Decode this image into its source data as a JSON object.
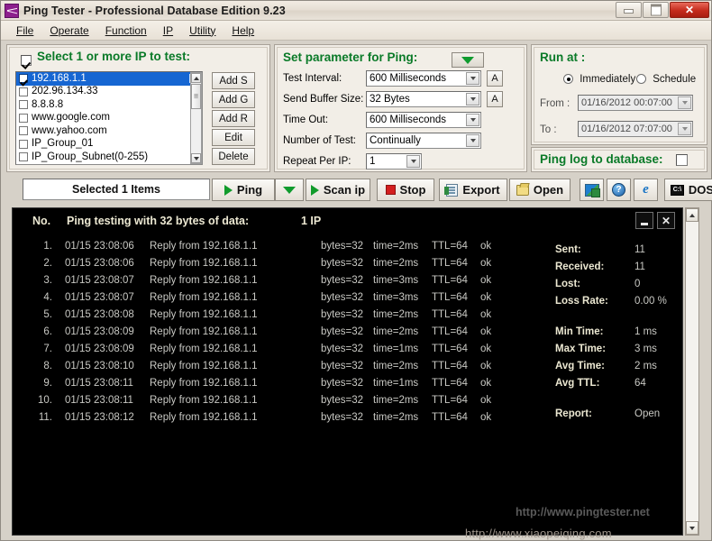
{
  "window": {
    "title": "Ping Tester - Professional Database Edition  9.23",
    "app_icon": "waveform-icon",
    "minimize": "minimize-icon",
    "maximize": "maximize-icon",
    "close": "✕"
  },
  "menu": [
    {
      "label": "File"
    },
    {
      "label": "Operate"
    },
    {
      "label": "Function"
    },
    {
      "label": "IP"
    },
    {
      "label": "Utility"
    },
    {
      "label": "Help"
    }
  ],
  "select_group": {
    "title": "Select 1 or more IP to test:",
    "checked": true,
    "items": [
      {
        "label": "192.168.1.1",
        "checked": true,
        "selected": true
      },
      {
        "label": "202.96.134.33",
        "checked": false,
        "selected": false
      },
      {
        "label": "8.8.8.8",
        "checked": false,
        "selected": false
      },
      {
        "label": "www.google.com",
        "checked": false,
        "selected": false
      },
      {
        "label": "www.yahoo.com",
        "checked": false,
        "selected": false
      },
      {
        "label": "IP_Group_01",
        "checked": false,
        "selected": false
      },
      {
        "label": "IP_Group_Subnet(0-255)",
        "checked": false,
        "selected": false
      }
    ],
    "buttons": [
      {
        "label": "Add S"
      },
      {
        "label": "Add G"
      },
      {
        "label": "Add R"
      },
      {
        "label": "Edit"
      },
      {
        "label": "Delete"
      }
    ]
  },
  "param_group": {
    "title": "Set parameter for Ping:",
    "dropdown_icon": "green-triangle-down-icon",
    "rows": [
      {
        "label": "Test Interval:",
        "value": "600  Milliseconds",
        "aux": "A"
      },
      {
        "label": "Send Buffer Size:",
        "value": "32  Bytes",
        "aux": "A"
      },
      {
        "label": "Time Out:",
        "value": "600  Milliseconds",
        "aux": ""
      },
      {
        "label": "Number of Test:",
        "value": "Continually",
        "aux": ""
      },
      {
        "label": "Repeat Per IP:",
        "value": "1",
        "aux": ""
      }
    ]
  },
  "runat_group": {
    "title": "Run at :",
    "radio_immediately": "Immediately",
    "radio_schedule": "Schedule",
    "selected_radio": "Immediately",
    "from_label": "From :",
    "from_value": "01/16/2012 00:07:00",
    "to_label": "To :",
    "to_value": "01/16/2012 07:07:00"
  },
  "pinglog_group": {
    "title": "Ping log to database:",
    "checked": false
  },
  "toolbar": {
    "selected_items": "Selected 1 Items",
    "ping_label": "Ping",
    "ping_dropdown_icon": "green-triangle-down-icon",
    "scan_label": "Scan ip",
    "stop_label": "Stop",
    "export_label": "Export",
    "open_label": "Open",
    "image_icon": "image-export-icon",
    "help_icon": "help-question-icon",
    "browser_icon": "internet-explorer-icon",
    "dos_label": "DOS",
    "dos_icon": "dos-console-icon"
  },
  "console": {
    "header_no": "No.",
    "header_title": "Ping testing with 32 bytes of data:",
    "header_ipcount": "1  IP",
    "minimize_icon": "minimize-icon",
    "close_icon": "✕",
    "rows": [
      {
        "no": "1.",
        "time": "01/15 23:08:06",
        "reply": "Reply from 192.168.1.1",
        "bytes": "bytes=32",
        "ms": "time=2ms",
        "ttl": "TTL=64",
        "status": "ok"
      },
      {
        "no": "2.",
        "time": "01/15 23:08:06",
        "reply": "Reply from 192.168.1.1",
        "bytes": "bytes=32",
        "ms": "time=2ms",
        "ttl": "TTL=64",
        "status": "ok"
      },
      {
        "no": "3.",
        "time": "01/15 23:08:07",
        "reply": "Reply from 192.168.1.1",
        "bytes": "bytes=32",
        "ms": "time=3ms",
        "ttl": "TTL=64",
        "status": "ok"
      },
      {
        "no": "4.",
        "time": "01/15 23:08:07",
        "reply": "Reply from 192.168.1.1",
        "bytes": "bytes=32",
        "ms": "time=3ms",
        "ttl": "TTL=64",
        "status": "ok"
      },
      {
        "no": "5.",
        "time": "01/15 23:08:08",
        "reply": "Reply from 192.168.1.1",
        "bytes": "bytes=32",
        "ms": "time=2ms",
        "ttl": "TTL=64",
        "status": "ok"
      },
      {
        "no": "6.",
        "time": "01/15 23:08:09",
        "reply": "Reply from 192.168.1.1",
        "bytes": "bytes=32",
        "ms": "time=2ms",
        "ttl": "TTL=64",
        "status": "ok"
      },
      {
        "no": "7.",
        "time": "01/15 23:08:09",
        "reply": "Reply from 192.168.1.1",
        "bytes": "bytes=32",
        "ms": "time=1ms",
        "ttl": "TTL=64",
        "status": "ok"
      },
      {
        "no": "8.",
        "time": "01/15 23:08:10",
        "reply": "Reply from 192.168.1.1",
        "bytes": "bytes=32",
        "ms": "time=2ms",
        "ttl": "TTL=64",
        "status": "ok"
      },
      {
        "no": "9.",
        "time": "01/15 23:08:11",
        "reply": "Reply from 192.168.1.1",
        "bytes": "bytes=32",
        "ms": "time=1ms",
        "ttl": "TTL=64",
        "status": "ok"
      },
      {
        "no": "10.",
        "time": "01/15 23:08:11",
        "reply": "Reply from 192.168.1.1",
        "bytes": "bytes=32",
        "ms": "time=2ms",
        "ttl": "TTL=64",
        "status": "ok"
      },
      {
        "no": "11.",
        "time": "01/15 23:08:12",
        "reply": "Reply from 192.168.1.1",
        "bytes": "bytes=32",
        "ms": "time=2ms",
        "ttl": "TTL=64",
        "status": "ok"
      }
    ],
    "stats": [
      {
        "label": "Sent:",
        "value": "11"
      },
      {
        "label": "Received:",
        "value": "11"
      },
      {
        "label": "Lost:",
        "value": "0"
      },
      {
        "label": "Loss Rate:",
        "value": "0.00 %"
      },
      {
        "label": "Min Time:",
        "value": "1 ms"
      },
      {
        "label": "Max Time:",
        "value": "3 ms"
      },
      {
        "label": "Avg Time:",
        "value": "2 ms"
      },
      {
        "label": "Avg TTL:",
        "value": "64"
      },
      {
        "label": "Report:",
        "value": "Open"
      }
    ],
    "watermark": "http://www.pingtester.net"
  },
  "page_watermark": "http://www.xiaopeiqing.com"
}
